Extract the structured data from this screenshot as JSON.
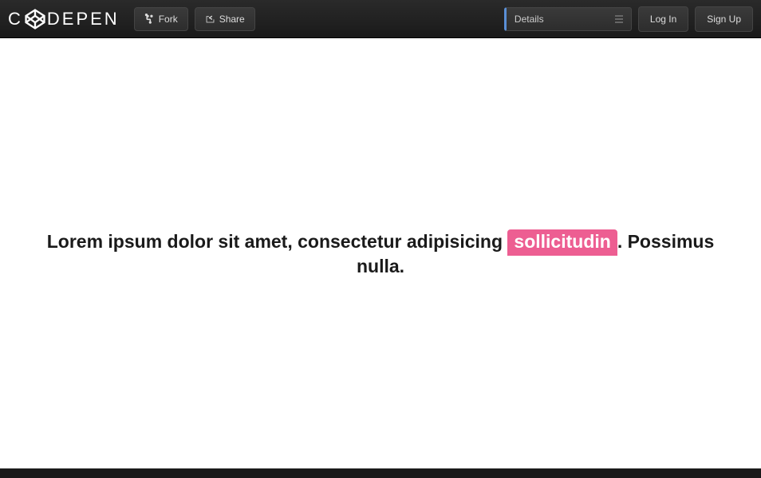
{
  "brand": {
    "text_before": "C",
    "text_after": "DEPEN"
  },
  "toolbar": {
    "fork_label": "Fork",
    "share_label": "Share"
  },
  "details": {
    "label": "Details"
  },
  "auth": {
    "login_label": "Log In",
    "signup_label": "Sign Up"
  },
  "content": {
    "text_before": "Lorem ipsum dolor sit amet, consectetur adipisicing ",
    "highlight": "sollicitudin",
    "text_after": ". Possimus nulla."
  }
}
